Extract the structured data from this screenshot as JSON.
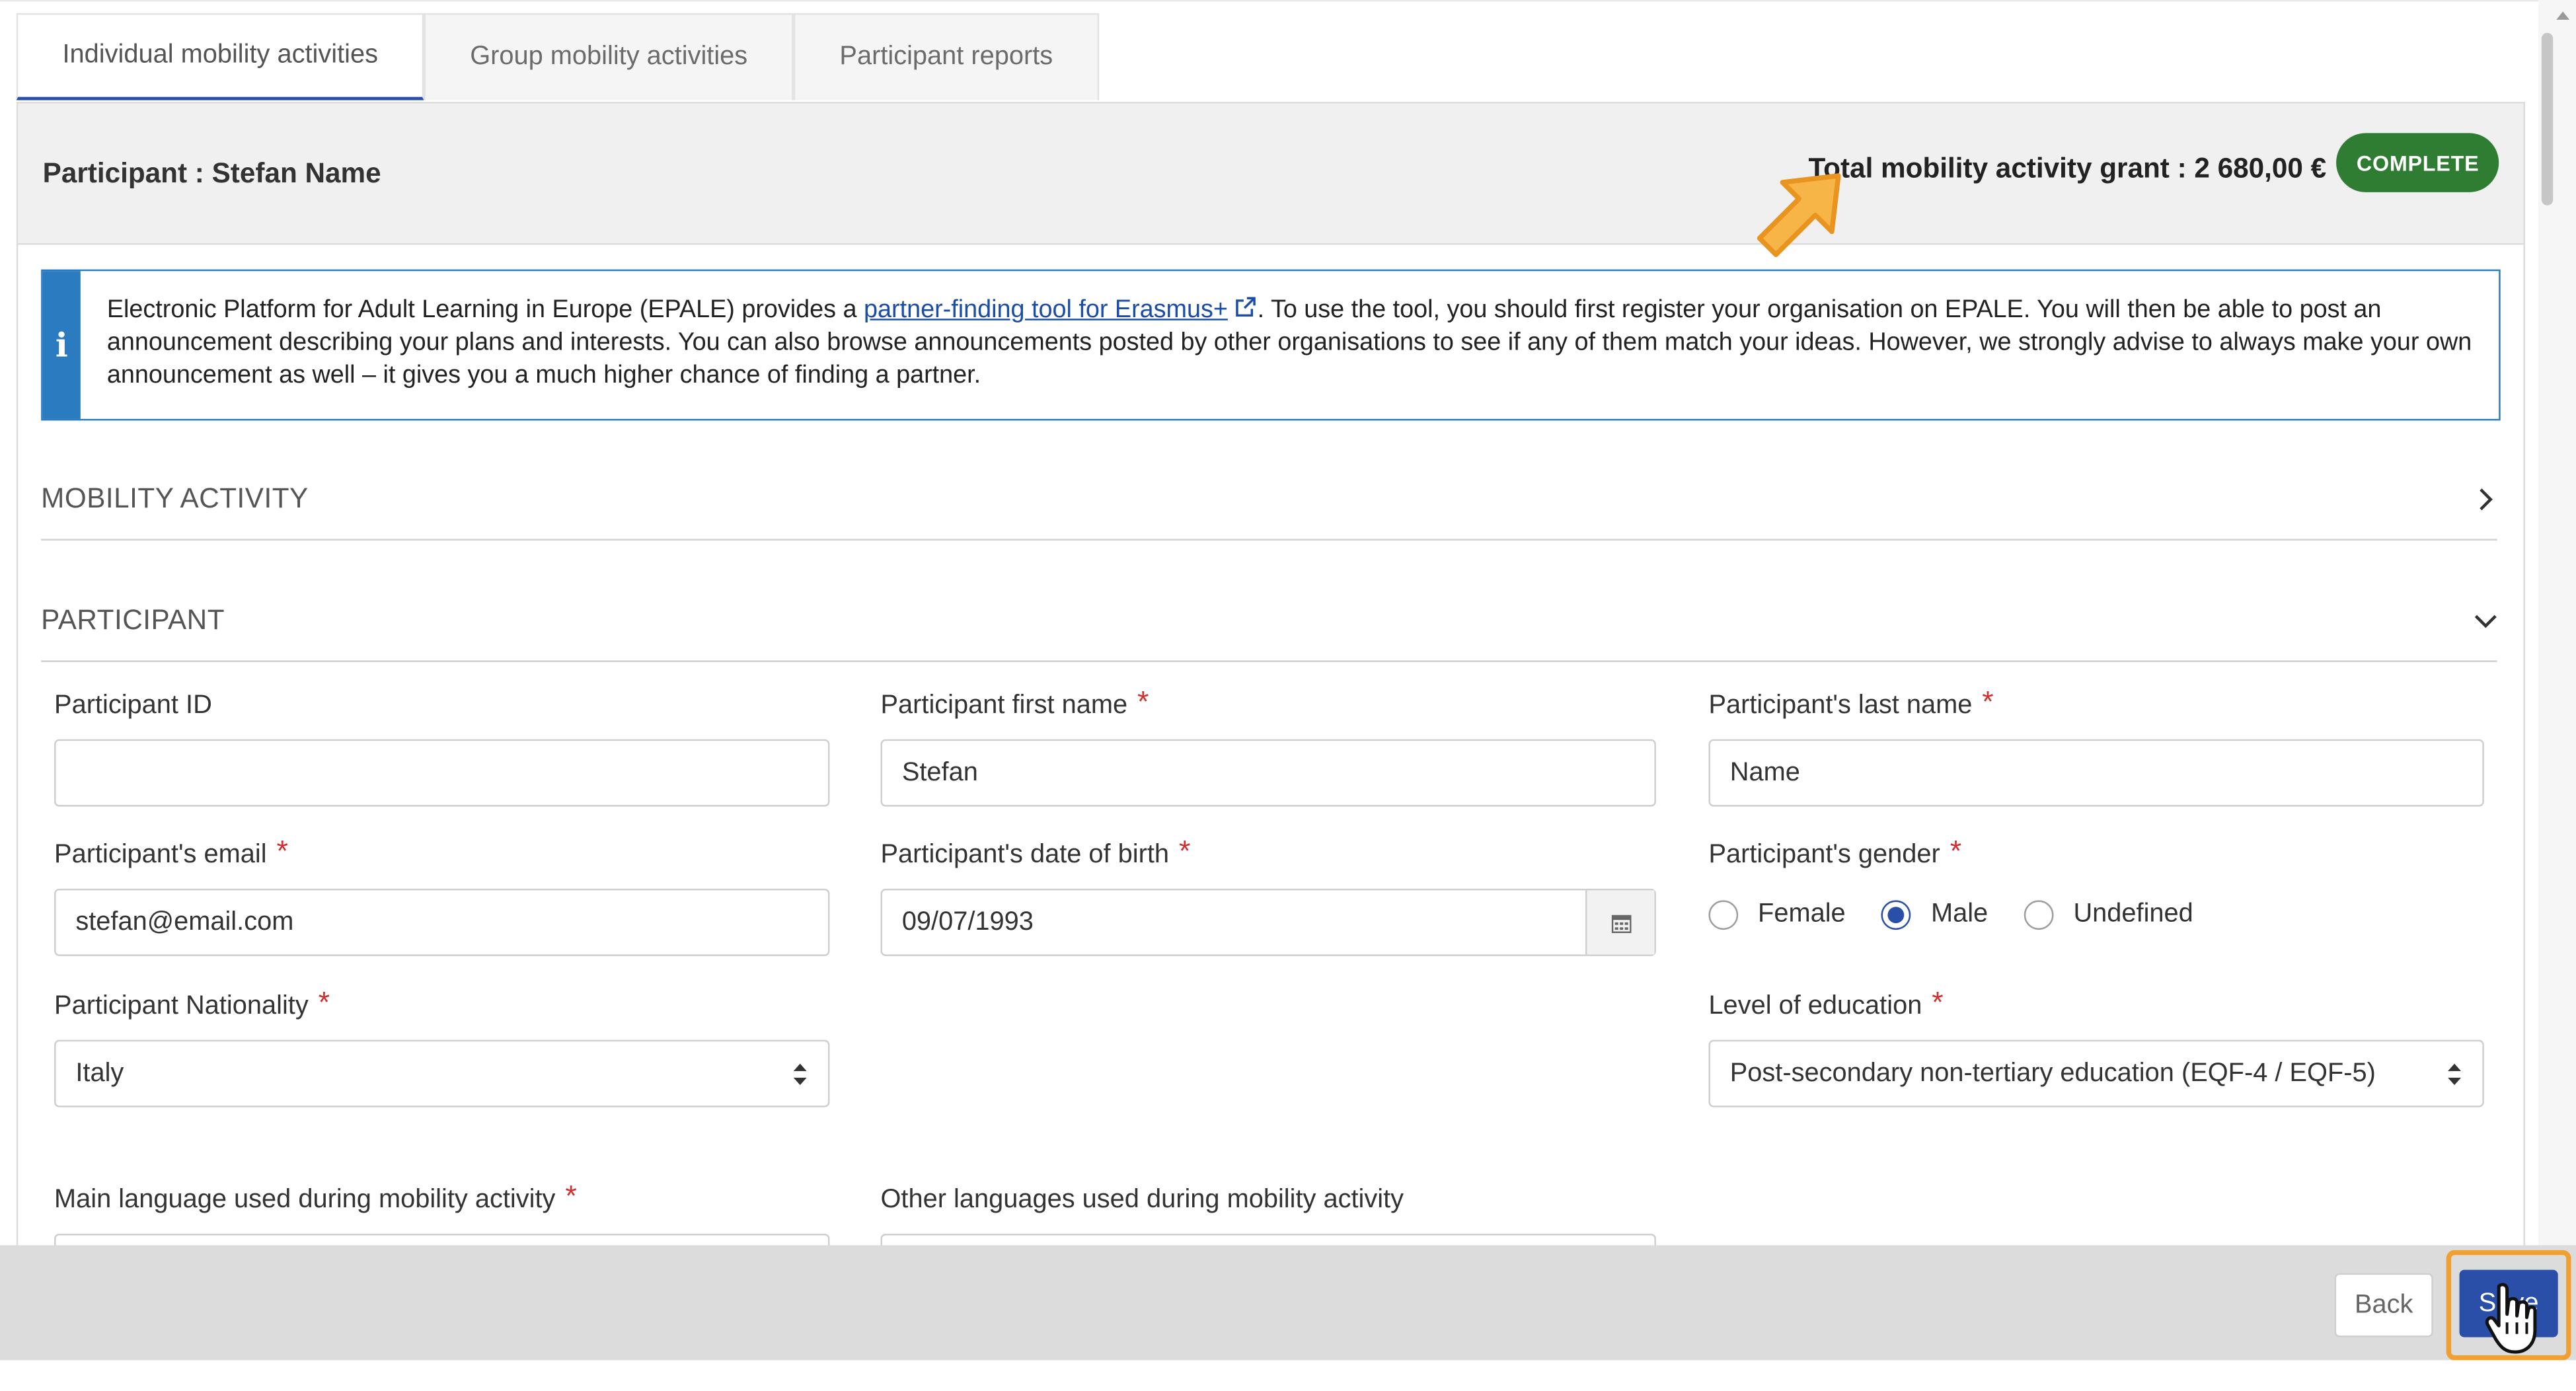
{
  "tabs": [
    {
      "label": "Individual mobility activities"
    },
    {
      "label": "Group mobility activities"
    },
    {
      "label": "Participant reports"
    }
  ],
  "header": {
    "participant_title": "Participant : Stefan Name",
    "grant_text": "Total mobility activity grant : 2 680,00 €",
    "status_badge": "COMPLETE"
  },
  "info": {
    "icon": "info-icon",
    "text_before": "Electronic Platform for Adult Learning in Europe (EPALE) provides a ",
    "link_text": "partner-finding tool for Erasmus+",
    "text_after": ". To use the tool, you should first register your organisation on EPALE. You will then be able to post an announcement describing your plans and interests. You can also browse announcements posted by other organisations to see if any of them match your ideas. However, we strongly advise to always make your own announcement as well – it gives you a much higher chance of finding a partner."
  },
  "sections": {
    "mobility_activity": "MOBILITY ACTIVITY",
    "participant": "PARTICIPANT"
  },
  "form": {
    "participant_id": {
      "label": "Participant ID",
      "value": ""
    },
    "first_name": {
      "label": "Participant first name",
      "value": "Stefan"
    },
    "last_name": {
      "label": "Participant's last name",
      "value": "Name"
    },
    "email": {
      "label": "Participant's email",
      "value": "stefan@email.com"
    },
    "dob": {
      "label": "Participant's date of birth",
      "value": "09/07/1993"
    },
    "gender": {
      "label": "Participant's gender",
      "options": [
        "Female",
        "Male",
        "Undefined"
      ],
      "selected": "Male"
    },
    "nationality": {
      "label": "Participant Nationality",
      "value": "Italy"
    },
    "education": {
      "label": "Level of education",
      "value": "Post-secondary non-tertiary education (EQF-4 / EQF-5)"
    },
    "main_language": {
      "label": "Main language used during mobility activity"
    },
    "other_languages": {
      "label": "Other languages used during mobility activity"
    },
    "required_mark": "*"
  },
  "footer": {
    "back_label": "Back",
    "save_label": "Save"
  },
  "colors": {
    "accent": "#2a4fa8",
    "badge": "#2e7d32",
    "info": "#2b7bc0",
    "highlight": "#f0a030",
    "required": "#d32f2f"
  }
}
